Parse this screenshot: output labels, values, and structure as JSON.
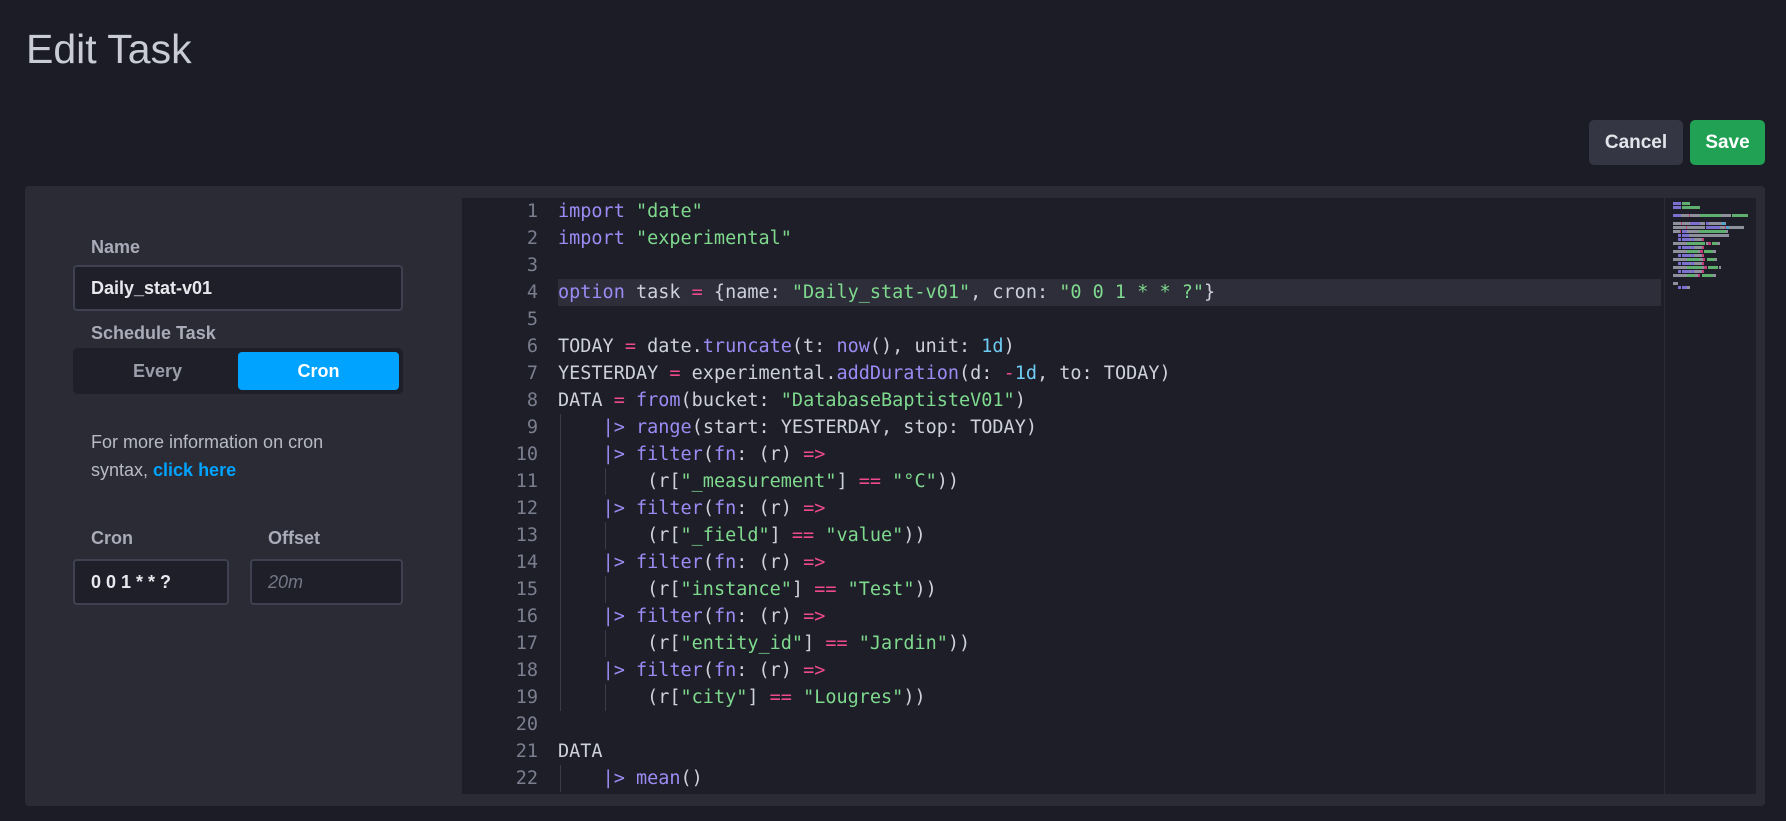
{
  "page": {
    "title": "Edit Task"
  },
  "actions": {
    "cancel_label": "Cancel",
    "save_label": "Save"
  },
  "form": {
    "name_label": "Name",
    "name_value": "Daily_stat-v01",
    "schedule_label": "Schedule Task",
    "schedule_options": [
      "Every",
      "Cron"
    ],
    "schedule_selected": "Cron",
    "info_text": "For more information on cron syntax, ",
    "info_link": "click here",
    "cron_label": "Cron",
    "cron_value": "0 0 1 * * ?",
    "offset_label": "Offset",
    "offset_placeholder": "20m"
  },
  "editor": {
    "active_line": 4,
    "lines": [
      [
        [
          "kw",
          "import"
        ],
        [
          "txt",
          " "
        ],
        [
          "str",
          "\"date\""
        ]
      ],
      [
        [
          "kw",
          "import"
        ],
        [
          "txt",
          " "
        ],
        [
          "str",
          "\"experimental\""
        ]
      ],
      [],
      [
        [
          "kw",
          "option"
        ],
        [
          "txt",
          " task "
        ],
        [
          "op",
          "="
        ],
        [
          "txt",
          " {name: "
        ],
        [
          "str",
          "\"Daily_stat-v01\""
        ],
        [
          "txt",
          ", cron: "
        ],
        [
          "str",
          "\"0 0 1 * * ?\""
        ],
        [
          "txt",
          "}"
        ]
      ],
      [],
      [
        [
          "txt",
          "TODAY "
        ],
        [
          "op",
          "="
        ],
        [
          "txt",
          " date."
        ],
        [
          "fn",
          "truncate"
        ],
        [
          "txt",
          "(t: "
        ],
        [
          "fn",
          "now"
        ],
        [
          "txt",
          "(), unit: "
        ],
        [
          "num",
          "1d"
        ],
        [
          "txt",
          ")"
        ]
      ],
      [
        [
          "txt",
          "YESTERDAY "
        ],
        [
          "op",
          "="
        ],
        [
          "txt",
          " experimental."
        ],
        [
          "fn",
          "addDuration"
        ],
        [
          "txt",
          "(d: "
        ],
        [
          "op",
          "-"
        ],
        [
          "num",
          "1d"
        ],
        [
          "txt",
          ", to: TODAY)"
        ]
      ],
      [
        [
          "txt",
          "DATA "
        ],
        [
          "op",
          "="
        ],
        [
          "txt",
          " "
        ],
        [
          "fn",
          "from"
        ],
        [
          "txt",
          "(bucket: "
        ],
        [
          "str",
          "\"DatabaseBaptisteV01\""
        ],
        [
          "txt",
          ")"
        ]
      ],
      [
        [
          "txt",
          "    "
        ],
        [
          "pipe",
          "|>"
        ],
        [
          "txt",
          " "
        ],
        [
          "fn",
          "range"
        ],
        [
          "txt",
          "(start: YESTERDAY, stop: TODAY)"
        ]
      ],
      [
        [
          "txt",
          "    "
        ],
        [
          "pipe",
          "|>"
        ],
        [
          "txt",
          " "
        ],
        [
          "fn",
          "filter"
        ],
        [
          "txt",
          "("
        ],
        [
          "fn",
          "fn"
        ],
        [
          "txt",
          ": (r) "
        ],
        [
          "op",
          "=>"
        ]
      ],
      [
        [
          "txt",
          "        (r["
        ],
        [
          "str",
          "\"_measurement\""
        ],
        [
          "txt",
          "] "
        ],
        [
          "op",
          "=="
        ],
        [
          "txt",
          " "
        ],
        [
          "str",
          "\"°C\""
        ],
        [
          "txt",
          "))"
        ]
      ],
      [
        [
          "txt",
          "    "
        ],
        [
          "pipe",
          "|>"
        ],
        [
          "txt",
          " "
        ],
        [
          "fn",
          "filter"
        ],
        [
          "txt",
          "("
        ],
        [
          "fn",
          "fn"
        ],
        [
          "txt",
          ": (r) "
        ],
        [
          "op",
          "=>"
        ]
      ],
      [
        [
          "txt",
          "        (r["
        ],
        [
          "str",
          "\"_field\""
        ],
        [
          "txt",
          "] "
        ],
        [
          "op",
          "=="
        ],
        [
          "txt",
          " "
        ],
        [
          "str",
          "\"value\""
        ],
        [
          "txt",
          "))"
        ]
      ],
      [
        [
          "txt",
          "    "
        ],
        [
          "pipe",
          "|>"
        ],
        [
          "txt",
          " "
        ],
        [
          "fn",
          "filter"
        ],
        [
          "txt",
          "("
        ],
        [
          "fn",
          "fn"
        ],
        [
          "txt",
          ": (r) "
        ],
        [
          "op",
          "=>"
        ]
      ],
      [
        [
          "txt",
          "        (r["
        ],
        [
          "str",
          "\"instance\""
        ],
        [
          "txt",
          "] "
        ],
        [
          "op",
          "=="
        ],
        [
          "txt",
          " "
        ],
        [
          "str",
          "\"Test\""
        ],
        [
          "txt",
          "))"
        ]
      ],
      [
        [
          "txt",
          "    "
        ],
        [
          "pipe",
          "|>"
        ],
        [
          "txt",
          " "
        ],
        [
          "fn",
          "filter"
        ],
        [
          "txt",
          "("
        ],
        [
          "fn",
          "fn"
        ],
        [
          "txt",
          ": (r) "
        ],
        [
          "op",
          "=>"
        ]
      ],
      [
        [
          "txt",
          "        (r["
        ],
        [
          "str",
          "\"entity_id\""
        ],
        [
          "txt",
          "] "
        ],
        [
          "op",
          "=="
        ],
        [
          "txt",
          " "
        ],
        [
          "str",
          "\"Jardin\""
        ],
        [
          "txt",
          "))"
        ]
      ],
      [
        [
          "txt",
          "    "
        ],
        [
          "pipe",
          "|>"
        ],
        [
          "txt",
          " "
        ],
        [
          "fn",
          "filter"
        ],
        [
          "txt",
          "("
        ],
        [
          "fn",
          "fn"
        ],
        [
          "txt",
          ": (r) "
        ],
        [
          "op",
          "=>"
        ]
      ],
      [
        [
          "txt",
          "        (r["
        ],
        [
          "str",
          "\"city\""
        ],
        [
          "txt",
          "] "
        ],
        [
          "op",
          "=="
        ],
        [
          "txt",
          " "
        ],
        [
          "str",
          "\"Lougres\""
        ],
        [
          "txt",
          "))"
        ]
      ],
      [],
      [
        [
          "txt",
          "DATA"
        ]
      ],
      [
        [
          "txt",
          "    "
        ],
        [
          "pipe",
          "|>"
        ],
        [
          "txt",
          " "
        ],
        [
          "fn",
          "mean"
        ],
        [
          "txt",
          "()"
        ]
      ]
    ]
  },
  "colors": {
    "background": "#1b1c25",
    "panel": "#2a2b35",
    "accent": "#00a3ff",
    "save": "#21a154",
    "keyword": "#9b8cf5",
    "string": "#7fd98e",
    "operator": "#ef4a8f",
    "number": "#6fcdf5"
  }
}
